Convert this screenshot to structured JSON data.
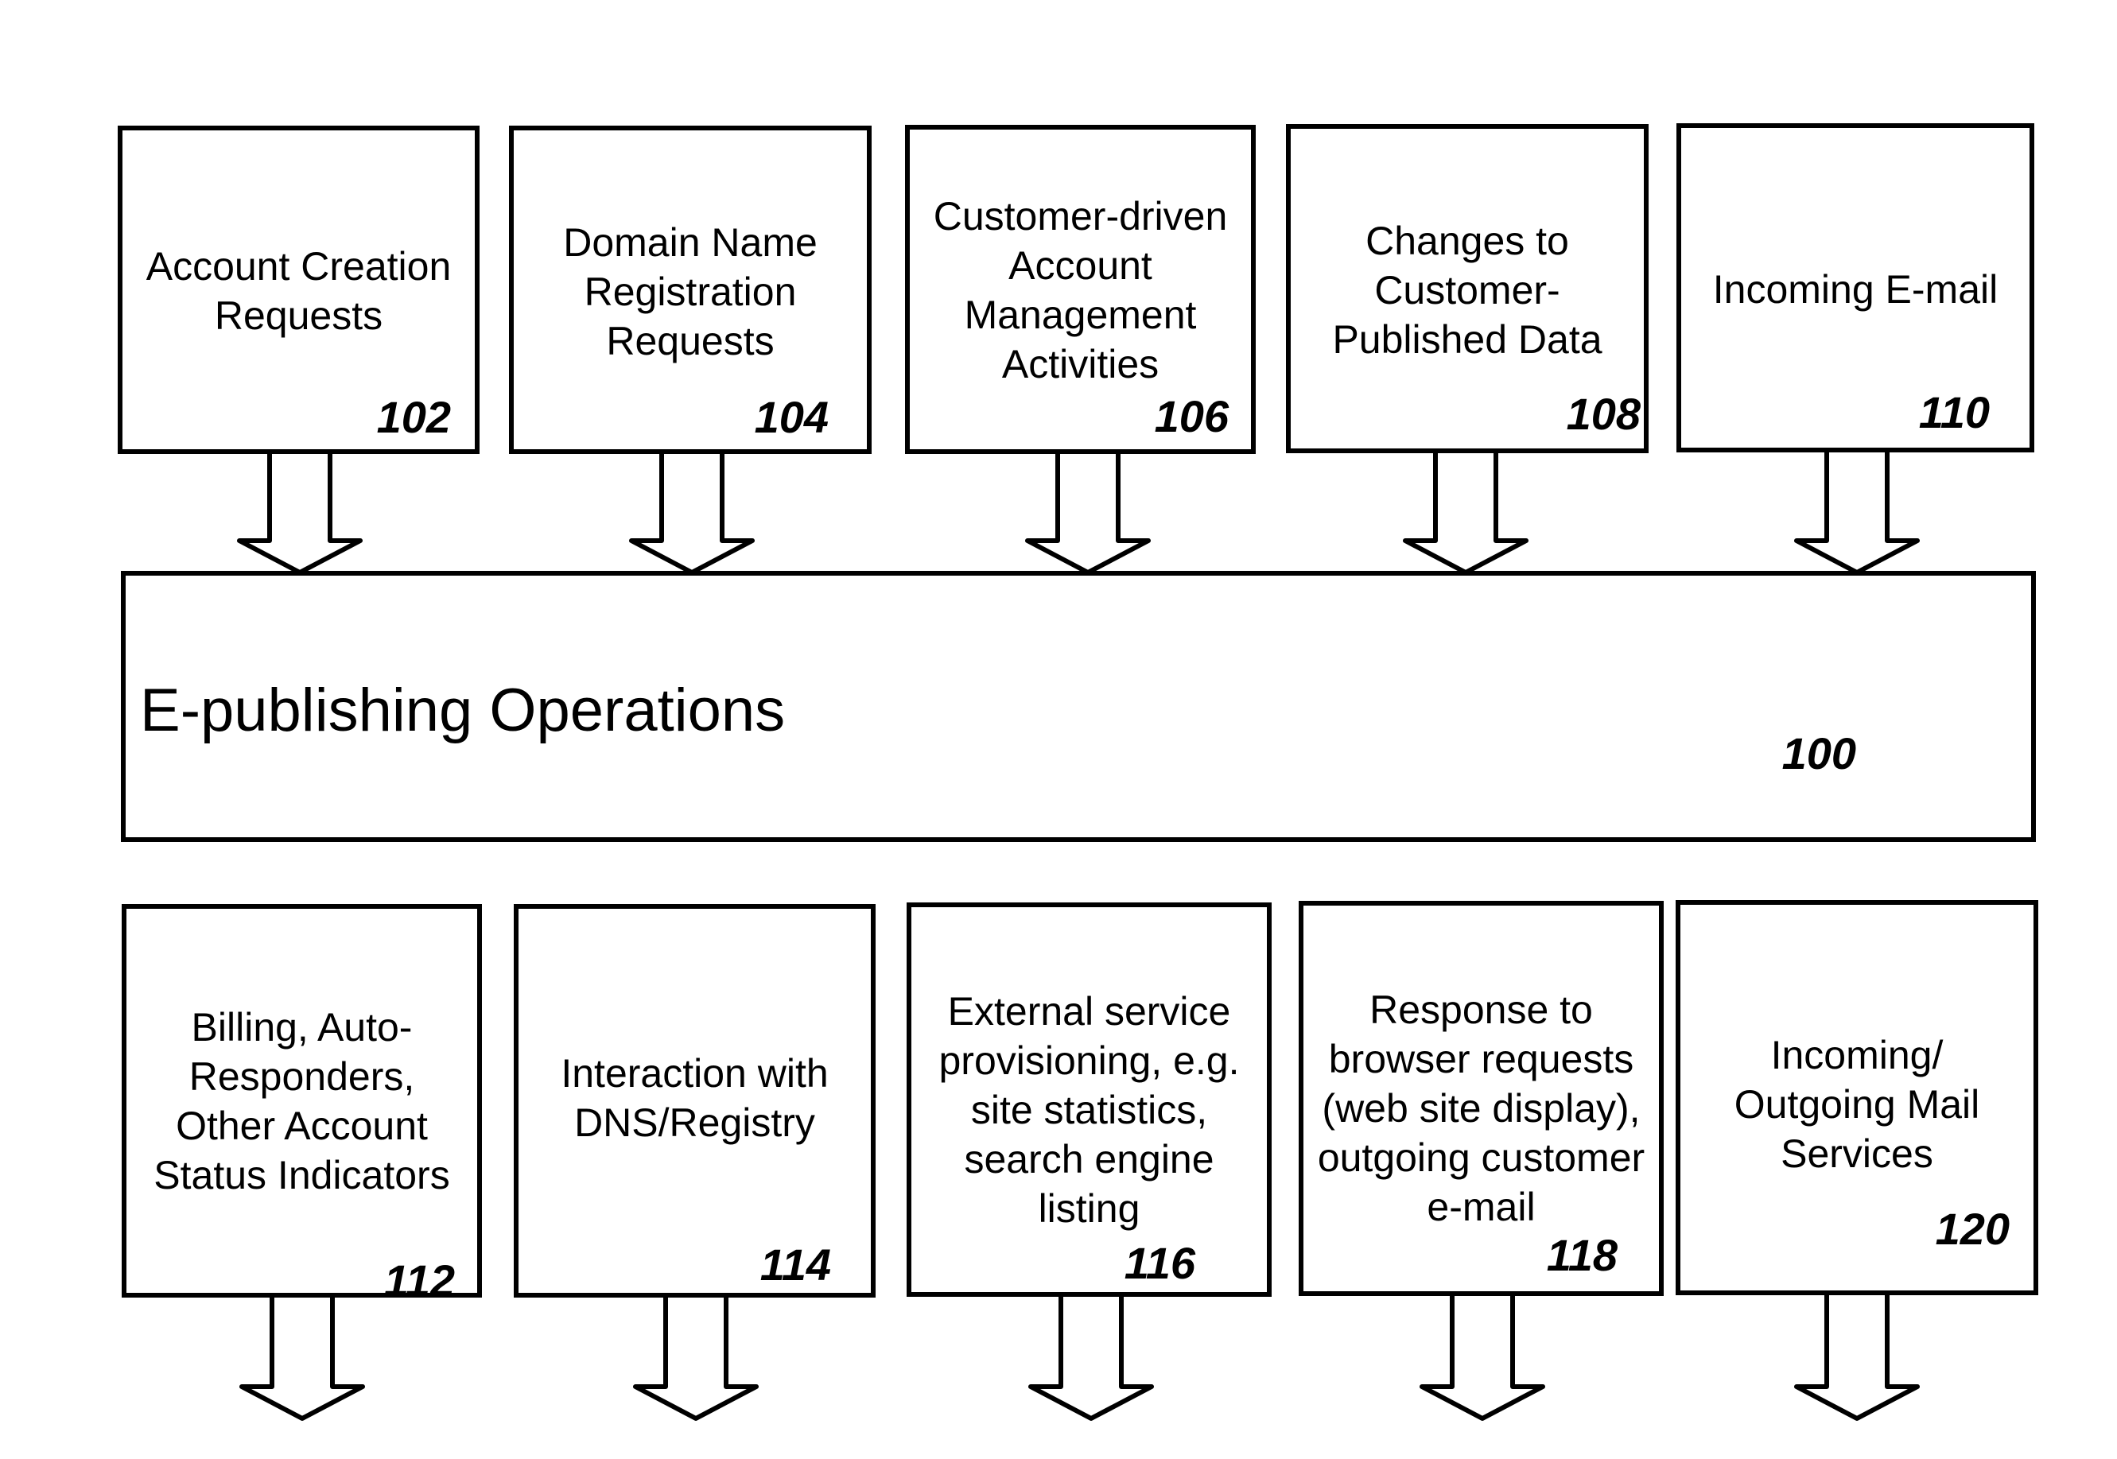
{
  "diagram": {
    "main": {
      "title": "E-publishing Operations",
      "ref": "100"
    },
    "inputs": [
      {
        "text": "Account Creation\nRequests",
        "ref": "102"
      },
      {
        "text": "Domain Name\nRegistration\nRequests",
        "ref": "104"
      },
      {
        "text": "Customer-driven\nAccount\nManagement\nActivities",
        "ref": "106"
      },
      {
        "text": "Changes to\nCustomer-\nPublished Data",
        "ref": "108"
      },
      {
        "text": "Incoming E-mail",
        "ref": "110"
      }
    ],
    "outputs": [
      {
        "text": "Billing, Auto-\nResponders,\nOther Account\nStatus Indicators",
        "ref": "112"
      },
      {
        "text": "Interaction with\nDNS/Registry",
        "ref": "114"
      },
      {
        "text": "External service\nprovisioning, e.g.\nsite statistics,\nsearch engine\nlisting",
        "ref": "116"
      },
      {
        "text": "Response to\nbrowser requests\n(web site display),\noutgoing customer\ne-mail",
        "ref": "118"
      },
      {
        "text": "Incoming/\nOutgoing Mail\nServices",
        "ref": "120"
      }
    ]
  }
}
